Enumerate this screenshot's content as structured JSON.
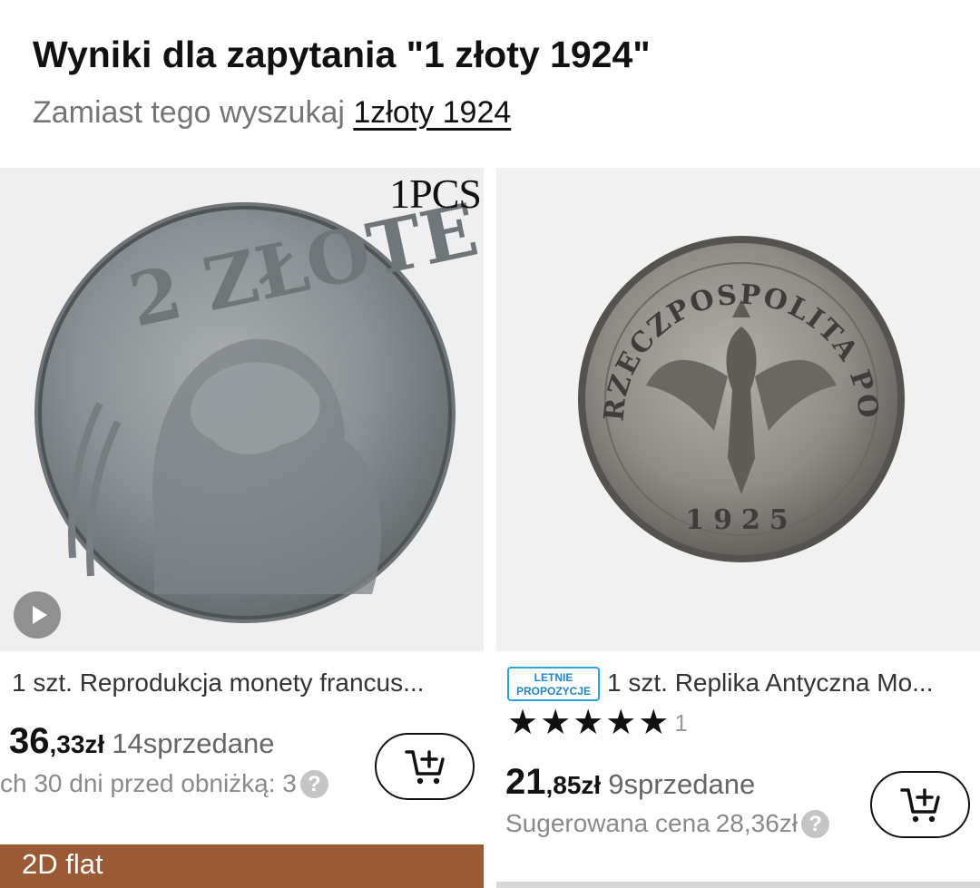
{
  "header": {
    "title": "Wyniki dla zapytania \"1 złoty 1924\"",
    "alt_prefix": "Zamiast tego wyszukaj",
    "alt_query": "1złoty 1924"
  },
  "products": [
    {
      "image_overlay": "1PCS",
      "coin_text": "2 ZŁOTE",
      "title": "1 szt. Reprodukcja monety francus...",
      "price_int": "36",
      "price_dec": ",33zł",
      "sold_count": "14",
      "sold_label": "sprzedane",
      "note": "ch 30 dni przed obniżką: 3",
      "help_icon": "question-icon",
      "cart_icon": "add-to-cart-icon"
    },
    {
      "badge_line1": "LETNIE",
      "badge_line2": "PROPOZYCJE",
      "coin_ring_text": "RZECZPOSPOLITA POLSKA",
      "coin_year": "1925",
      "title": "1 szt. Replika Antyczna Mo...",
      "stars": "★★★★★",
      "rating_count": "1",
      "price_int": "21",
      "price_dec": ",85zł",
      "sold_count": "9",
      "sold_label": "sprzedane",
      "suggested_label": "Sugerowana cena",
      "suggested_price": "28,36zł",
      "help_icon": "question-icon",
      "cart_icon": "add-to-cart-icon"
    }
  ],
  "next_row": {
    "label": "2D flat"
  },
  "colors": {
    "badge_border": "#2aa2e2",
    "next_image": "#9a5a36"
  }
}
